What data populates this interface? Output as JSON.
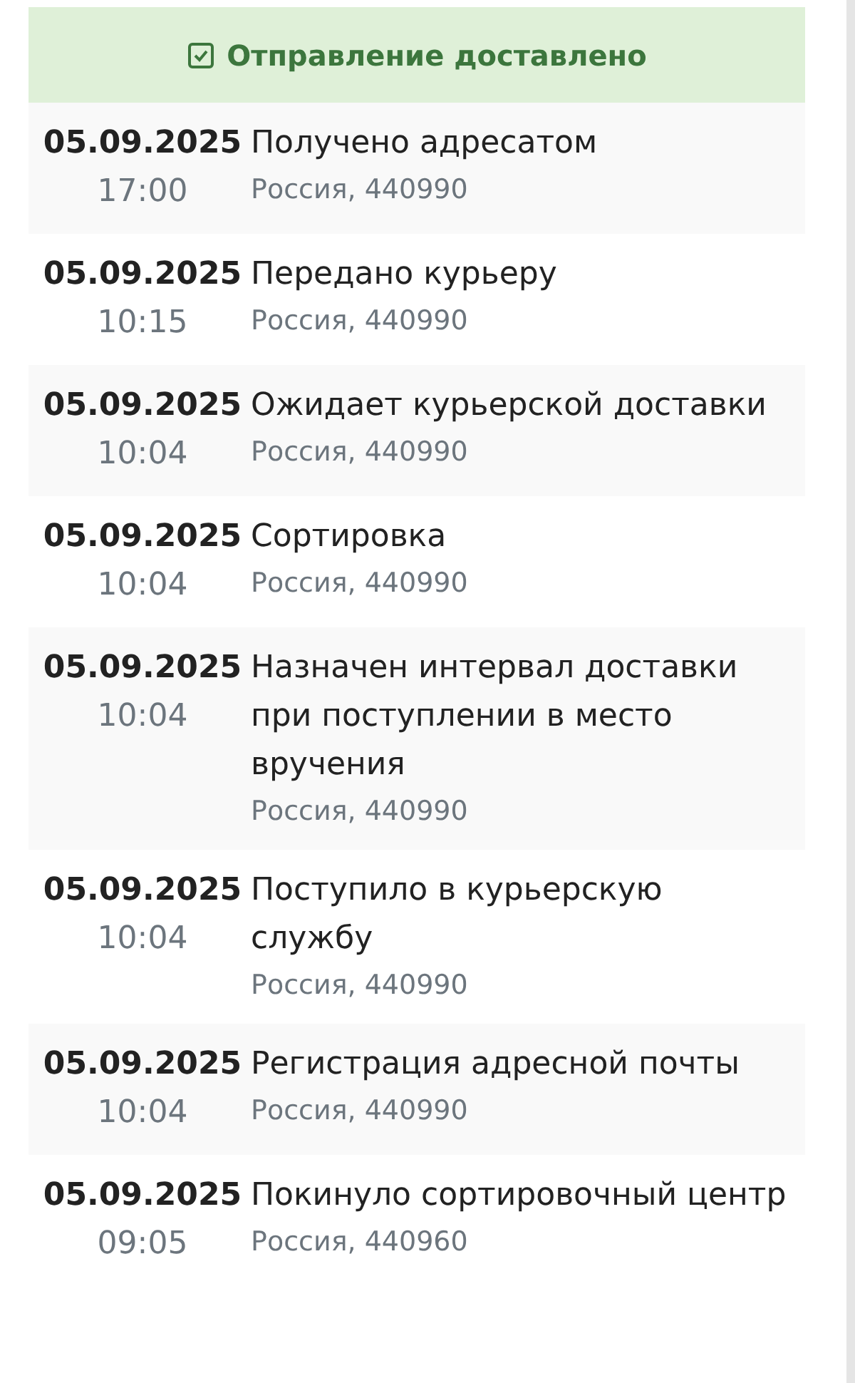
{
  "status": {
    "title": "Отправление доставлено"
  },
  "events": [
    {
      "date": "05.09.2025",
      "time": "17:00",
      "title": "Получено адресатом",
      "location": "Россия, 440990"
    },
    {
      "date": "05.09.2025",
      "time": "10:15",
      "title": "Передано курьеру",
      "location": "Россия, 440990"
    },
    {
      "date": "05.09.2025",
      "time": "10:04",
      "title": "Ожидает курьерской доставки",
      "location": "Россия, 440990"
    },
    {
      "date": "05.09.2025",
      "time": "10:04",
      "title": "Сортировка",
      "location": "Россия, 440990"
    },
    {
      "date": "05.09.2025",
      "time": "10:04",
      "title": "Назначен интервал доставки при поступлении в место вручения",
      "location": "Россия, 440990"
    },
    {
      "date": "05.09.2025",
      "time": "10:04",
      "title": "Поступило в курьерскую службу",
      "location": "Россия, 440990"
    },
    {
      "date": "05.09.2025",
      "time": "10:04",
      "title": "Регистрация адресной почты",
      "location": "Россия, 440990"
    },
    {
      "date": "05.09.2025",
      "time": "09:05",
      "title": "Покинуло сортировочный центр",
      "location": "Россия, 440960"
    }
  ]
}
